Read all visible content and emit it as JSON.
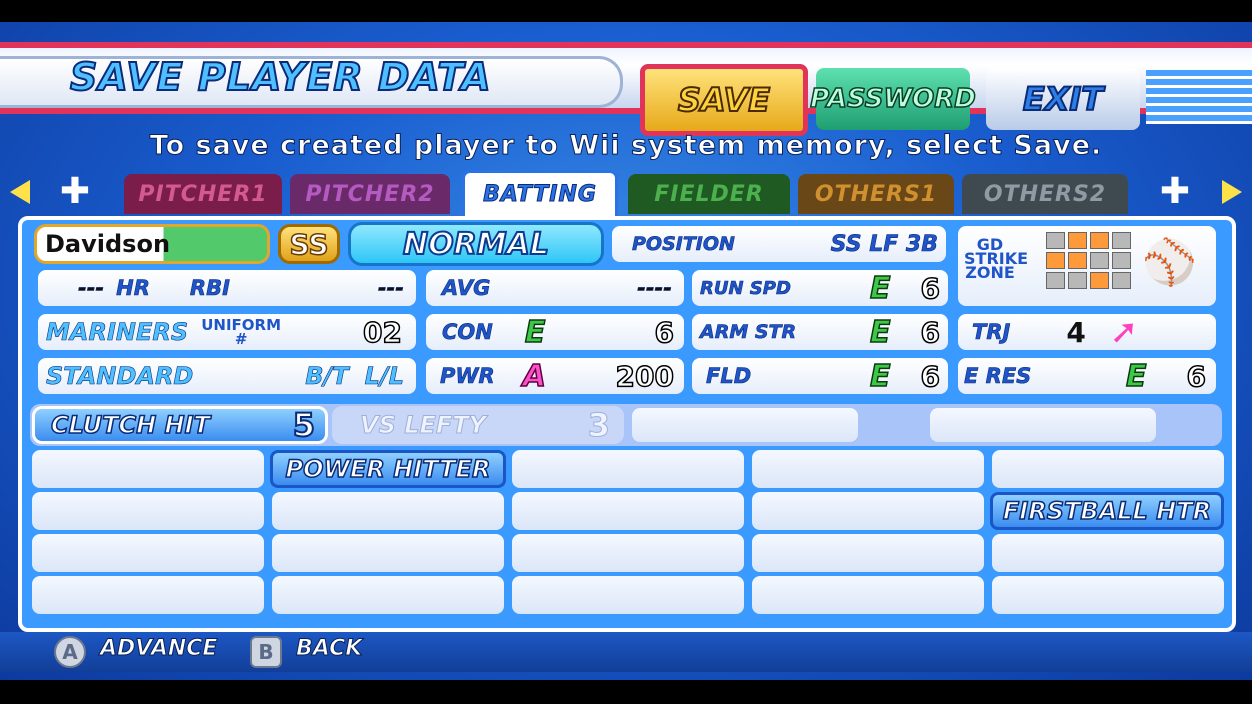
{
  "header": {
    "title": "Save Player Data",
    "save_label": "Save",
    "password_label": "Password",
    "exit_label": "Exit"
  },
  "instruction": "To save created player to Wii system memory, select Save.",
  "tabs": [
    {
      "label": "Pitcher1"
    },
    {
      "label": "Pitcher2"
    },
    {
      "label": "Batting"
    },
    {
      "label": "Fielder"
    },
    {
      "label": "Others1"
    },
    {
      "label": "Others2"
    }
  ],
  "player": {
    "name": "Davidson",
    "position_badge": "SS",
    "type": "Normal",
    "position_label": "Position",
    "positions": "SS LF 3B",
    "zone_label": "Gd STRIKE ZONE",
    "hr_value": "---",
    "hr_label": "HR",
    "rbi_label": "RBI",
    "rbi_value": "---",
    "avg_label": "AVG",
    "avg_value": "----",
    "run_spd_label": "Run Spd",
    "run_spd_grade": "E",
    "run_spd_value": "6",
    "team": "Mariners",
    "uniform_label": "Uniform #",
    "uniform_number": "02",
    "con_label": "Con",
    "con_grade": "E",
    "con_value": "6",
    "arm_str_label": "Arm Str",
    "arm_str_grade": "E",
    "arm_str_value": "6",
    "trj_label": "TRJ",
    "trj_value": "4",
    "stance": "Standard",
    "bt_label": "B/T",
    "bt_value": "L/L",
    "pwr_label": "PWR",
    "pwr_grade": "A",
    "pwr_value": "200",
    "fld_label": "FLD",
    "fld_grade": "E",
    "fld_value": "6",
    "eres_label": "E Res",
    "eres_grade": "E",
    "eres_value": "6"
  },
  "abilities_top": [
    {
      "label": "Clutch Hit",
      "value": "5"
    },
    {
      "label": "VS Lefty",
      "value": "3"
    }
  ],
  "abilities": {
    "power_hitter": "Power Hitter",
    "firstball_htr": "Firstball HTR"
  },
  "footer": {
    "a_button": "A",
    "advance": "Advance",
    "b_button": "B",
    "back": "Back"
  },
  "colors": {
    "accent_red": "#e2345a",
    "panel_blue": "#3a9aff",
    "grade_e": "#3ec84a",
    "grade_a": "#ff4fc8"
  }
}
